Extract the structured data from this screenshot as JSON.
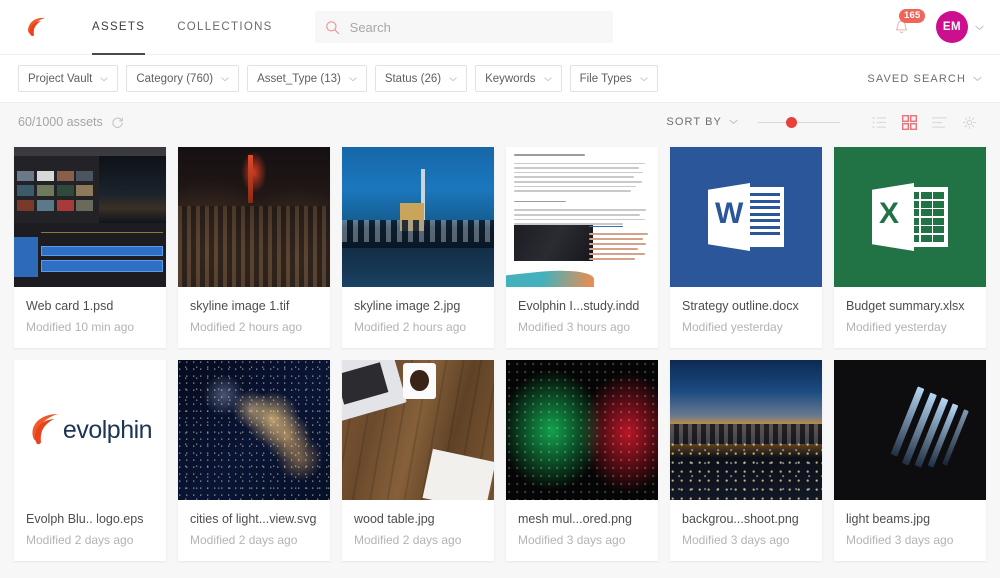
{
  "header": {
    "logo_icon": "evolphin-dolphin-logo",
    "tabs": [
      {
        "label": "ASSETS",
        "active": true
      },
      {
        "label": "COLLECTIONS",
        "active": false
      }
    ],
    "search": {
      "placeholder": "Search",
      "value": "",
      "icon": "search-icon"
    },
    "notifications": {
      "icon": "bell-icon",
      "count": "165"
    },
    "avatar": {
      "initials": "EM",
      "color": "#cc0f8f",
      "chevron": "chevron-down-icon"
    }
  },
  "filters": {
    "chips": [
      {
        "label": "Project Vault"
      },
      {
        "label": "Category (760)"
      },
      {
        "label": "Asset_Type (13)"
      },
      {
        "label": "Status (26)"
      },
      {
        "label": "Keywords"
      },
      {
        "label": "File Types"
      }
    ],
    "saved_search": {
      "label": "SAVED SEARCH",
      "icon": "chevron-down-icon"
    }
  },
  "toolbar": {
    "asset_count": "60/1000 assets",
    "refresh_icon": "refresh-icon",
    "sort_by": "SORT BY",
    "thumb_size_slider": {
      "value": 35
    },
    "views": [
      {
        "name": "list-view",
        "active": false
      },
      {
        "name": "grid-view",
        "active": true
      },
      {
        "name": "detail-view",
        "active": false
      },
      {
        "name": "settings-gear",
        "active": false
      }
    ],
    "accent_color": "#e8403a"
  },
  "assets": [
    {
      "name": "Web card 1.psd",
      "modified": "Modified 10 min ago",
      "thumb": "psd"
    },
    {
      "name": "skyline image 1.tif",
      "modified": "Modified 2 hours ago",
      "thumb": "nyc-night"
    },
    {
      "name": "skyline image 2.jpg",
      "modified": "Modified 2 hours ago",
      "thumb": "skyline-blue"
    },
    {
      "name": "Evolphin I...study.indd",
      "modified": "Modified 3 hours ago",
      "thumb": "indd"
    },
    {
      "name": "Strategy outline.docx",
      "modified": "Modified yesterday",
      "thumb": "word"
    },
    {
      "name": "Budget summary.xlsx",
      "modified": "Modified yesterday",
      "thumb": "excel"
    },
    {
      "name": "Evolph Blu.. logo.eps",
      "modified": "Modified 2 days ago",
      "thumb": "logo"
    },
    {
      "name": "cities of light...view.svg",
      "modified": "Modified 2 days ago",
      "thumb": "cities"
    },
    {
      "name": "wood table.jpg",
      "modified": "Modified 2 days ago",
      "thumb": "wood"
    },
    {
      "name": "mesh mul...ored.png",
      "modified": "Modified 3 days ago",
      "thumb": "mesh"
    },
    {
      "name": "backgrou...shoot.png",
      "modified": "Modified 3 days ago",
      "thumb": "la"
    },
    {
      "name": "light beams.jpg",
      "modified": "Modified 3 days ago",
      "thumb": "beams"
    }
  ],
  "thumb_labels": {
    "word_letter": "W",
    "excel_letter": "X",
    "logo_text": "evolphin"
  }
}
